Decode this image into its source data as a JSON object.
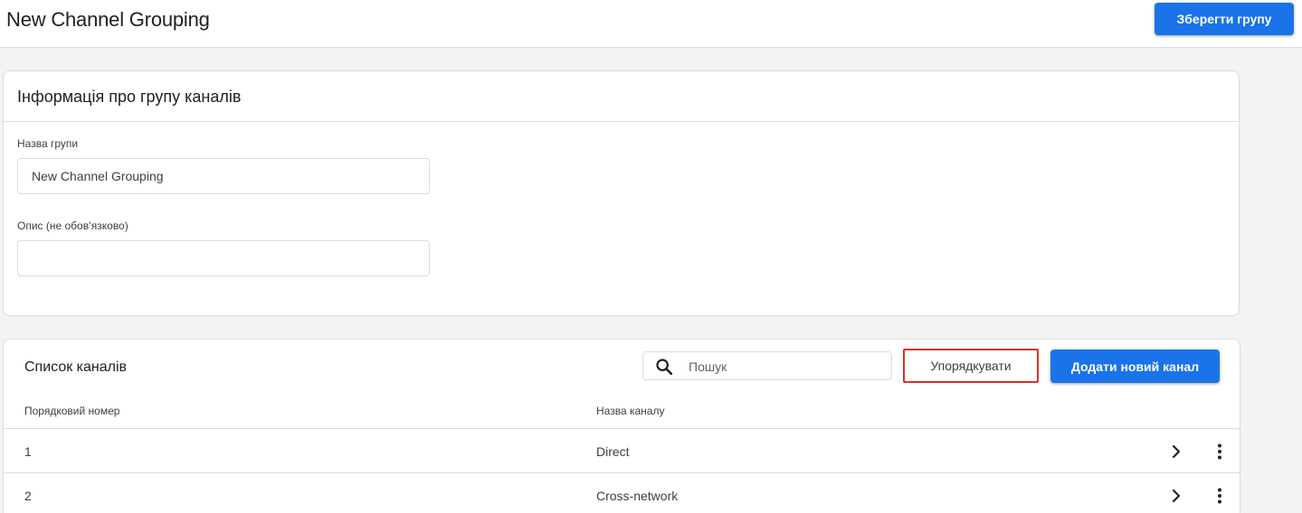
{
  "header": {
    "title": "New Channel Grouping",
    "save_label": "Зберегти групу"
  },
  "group_info": {
    "title": "Інформація про групу каналів",
    "name_label": "Назва групи",
    "name_value": "New Channel Grouping",
    "description_label": "Опис (не обов’язково)",
    "description_value": ""
  },
  "channel_list": {
    "title": "Список каналів",
    "search_placeholder": "Пошук",
    "sort_label": "Упорядкувати",
    "add_label": "Додати новий канал",
    "columns": {
      "order": "Порядковий номер",
      "name": "Назва каналу"
    },
    "rows": [
      {
        "order": "1",
        "name": "Direct"
      },
      {
        "order": "2",
        "name": "Cross-network"
      }
    ]
  },
  "colors": {
    "primary": "#1a73e8",
    "highlight_border": "#d93025"
  },
  "icons": {
    "search": "search-icon",
    "row_open": "chevron-right-icon",
    "row_menu": "more-vert-icon"
  }
}
